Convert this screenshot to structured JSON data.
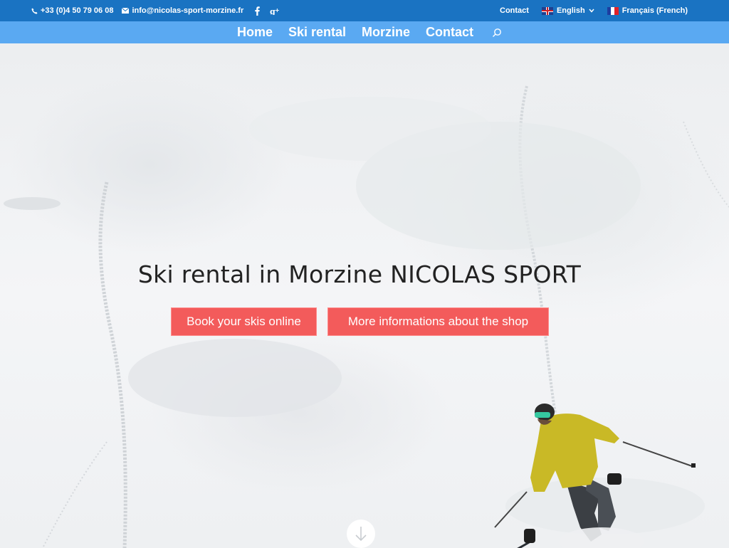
{
  "topbar": {
    "phone": "+33 (0)4 50 79 06 08",
    "email": "info@nicolas-sport-morzine.fr",
    "social": [
      "facebook-icon",
      "google-plus-icon"
    ],
    "contact_link": "Contact",
    "language_current": "English",
    "language_alt": "Français (French)"
  },
  "nav": {
    "items": [
      {
        "label": "Home",
        "active": true
      },
      {
        "label": "Ski rental",
        "active": false
      },
      {
        "label": "Morzine",
        "active": false
      },
      {
        "label": "Contact",
        "active": false
      }
    ]
  },
  "hero": {
    "title": "Ski rental in Morzine NICOLAS SPORT",
    "button_book": "Book your skis online",
    "button_info": "More informations about the shop"
  },
  "colors": {
    "topbar": "#1a73c2",
    "nav": "#5aa9f2",
    "button": "#f35b5b"
  }
}
